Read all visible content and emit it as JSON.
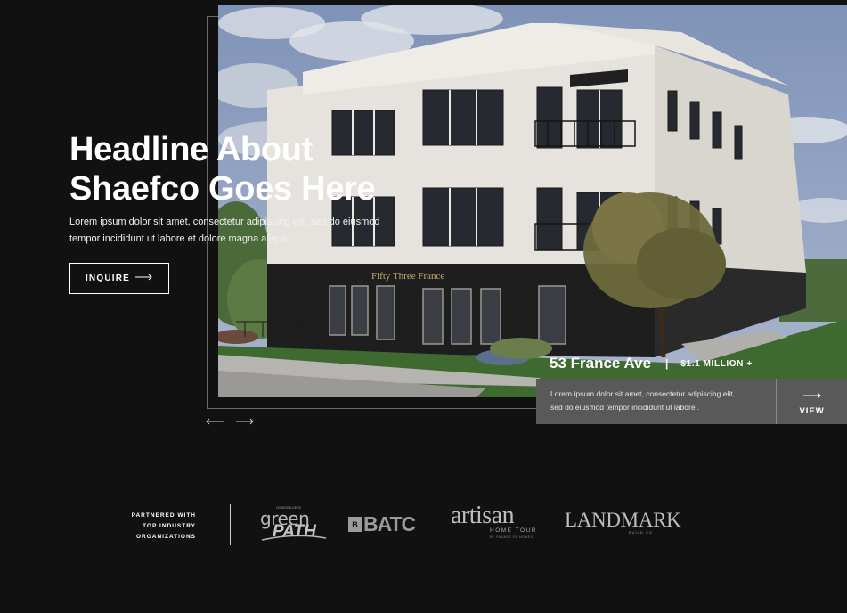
{
  "hero": {
    "headline_line1": "Headline About",
    "headline_line2": "Shaefco Goes Here",
    "lede_line1": "Lorem ipsum dolor sit amet, consectetur adipiscing elit, sed do eiusmod",
    "lede_line2": "tempor incididunt ut labore et dolore magna aliqua.",
    "cta_label": "INQUIRE",
    "building_sign": "Fifty Three France"
  },
  "listing": {
    "name": "53 France Ave",
    "separator": "|",
    "price": "$1.1 MILLION +",
    "desc_line1": "Lorem ipsum dolor sit amet, consectetur adipiscing elit,",
    "desc_line2": "sed do eiusmod tempor incididunt ut labore .",
    "view_label": "VIEW"
  },
  "partners": {
    "label_line1": "PARTNERED WITH",
    "label_line2": "TOP INDUSTRY",
    "label_line3": "ORGANIZATIONS",
    "logos": {
      "greenpath_kicker": "HOMEBUILDERS",
      "greenpath_word1": "green",
      "greenpath_word2": "PATH",
      "batc_mark": "B",
      "batc_text": "BATC",
      "artisan_word": "artisan",
      "artisan_sub": "HOME TOUR",
      "artisan_tiny": "BY PARADE OF HOMES",
      "landmark_word": "LANDMARK",
      "landmark_sub": "BUILD CO"
    }
  },
  "icons": {
    "prev": "arrow-left-icon",
    "next": "arrow-right-icon",
    "cta": "arrow-right-icon",
    "view": "arrow-right-icon"
  },
  "colors": {
    "background": "#111112",
    "listing_card": "#59595a",
    "text": "#ffffff",
    "logo_gray": "#b8b8b8"
  }
}
